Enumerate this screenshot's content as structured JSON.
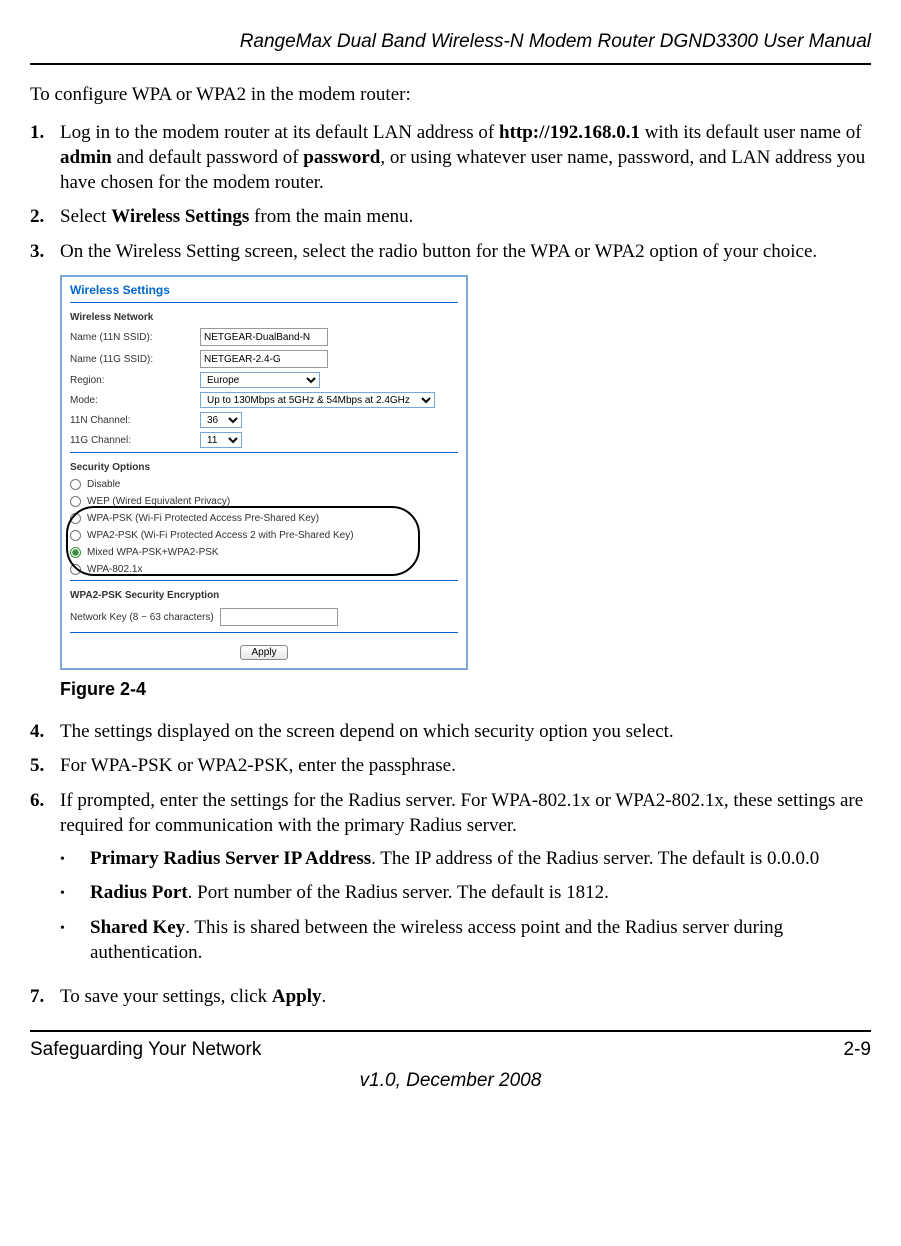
{
  "header": {
    "doc_title": "RangeMax Dual Band Wireless-N Modem Router DGND3300 User Manual"
  },
  "intro": "To configure WPA or WPA2 in the modem router:",
  "steps": {
    "s1": {
      "num": "1.",
      "pre": "Log in to the modem router at its default LAN address of ",
      "url": "http://192.168.0.1",
      "mid1": " with its default user name of ",
      "admin": "admin",
      "mid2": " and default password of ",
      "pw": "password",
      "post": ", or using whatever user name, password, and LAN address you have chosen for the modem router."
    },
    "s2": {
      "num": "2.",
      "pre": "Select ",
      "bold": "Wireless Settings",
      "post": " from the main menu."
    },
    "s3": {
      "num": "3.",
      "text": "On the Wireless Setting screen, select the radio button for the WPA or WPA2 option of your choice."
    },
    "s4": {
      "num": "4.",
      "text": "The settings displayed on the screen depend on which security option you select."
    },
    "s5": {
      "num": "5.",
      "text": "For WPA-PSK or WPA2-PSK, enter the passphrase."
    },
    "s6": {
      "num": "6.",
      "text": "If prompted, enter the settings for the Radius server. For WPA-802.1x or WPA2-802.1x, these settings are required for communication with the primary Radius server.",
      "sub": {
        "a": {
          "bold": "Primary Radius Server IP Address",
          "rest": ". The IP address of the Radius server. The default is 0.0.0.0"
        },
        "b": {
          "bold": "Radius Port",
          "rest": ". Port number of the Radius server. The default is 1812."
        },
        "c": {
          "bold": "Shared Key",
          "rest": ". This is shared between the wireless access point and the Radius server during authentication."
        }
      }
    },
    "s7": {
      "num": "7.",
      "pre": "To save your settings, click ",
      "bold": "Apply",
      "post": "."
    }
  },
  "figure": {
    "caption": "Figure 2-4",
    "panel_title": "Wireless Settings",
    "net_section": "Wireless Network",
    "rows": {
      "name11n_lbl": "Name (11N SSID):",
      "name11n_val": "NETGEAR-DualBand-N",
      "name11g_lbl": "Name (11G SSID):",
      "name11g_val": "NETGEAR-2.4-G",
      "region_lbl": "Region:",
      "region_val": "Europe",
      "mode_lbl": "Mode:",
      "mode_val": "Up to 130Mbps at 5GHz & 54Mbps at 2.4GHz",
      "ch11n_lbl": "11N Channel:",
      "ch11n_val": "36",
      "ch11g_lbl": "11G Channel:",
      "ch11g_val": "11"
    },
    "sec_section": "Security Options",
    "opts": {
      "o1": "Disable",
      "o2": "WEP (Wired Equivalent Privacy)",
      "o3": "WPA-PSK (Wi-Fi Protected Access Pre-Shared Key)",
      "o4": "WPA2-PSK (Wi-Fi Protected Access 2 with Pre-Shared Key)",
      "o5": "Mixed WPA-PSK+WPA2-PSK",
      "o6": "WPA-802.1x"
    },
    "enc_section": "WPA2-PSK Security Encryption",
    "enc_label": "Network Key (8 ~ 63 characters)",
    "apply": "Apply"
  },
  "footer": {
    "left": "Safeguarding Your Network",
    "right": "2-9",
    "version": "v1.0, December 2008"
  }
}
